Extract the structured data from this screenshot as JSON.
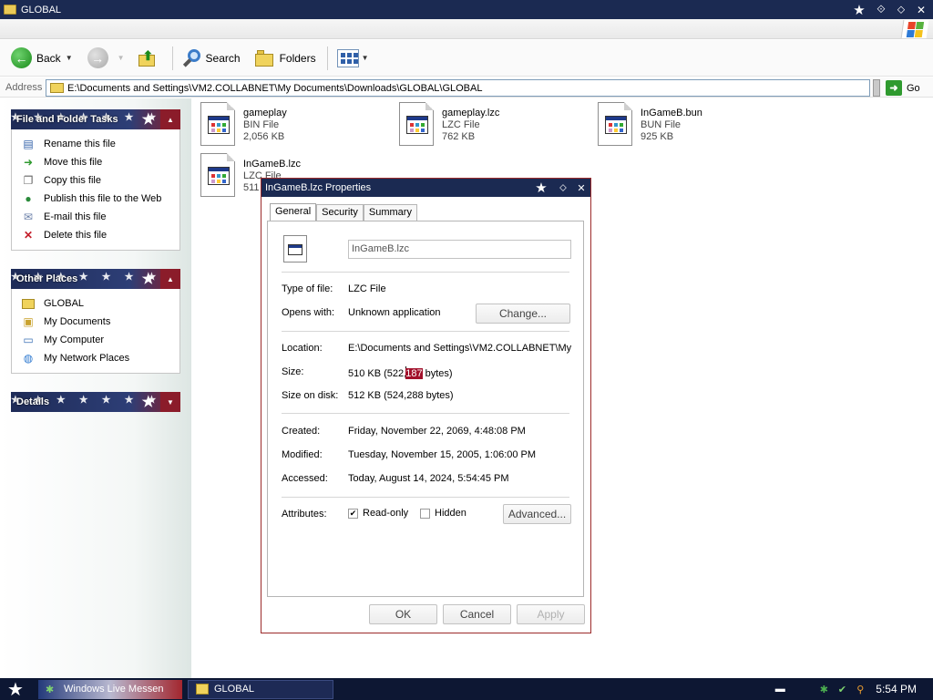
{
  "window": {
    "title": "GLOBAL"
  },
  "toolbar": {
    "back_label": "Back",
    "search_label": "Search",
    "folders_label": "Folders"
  },
  "address": {
    "label": "Address",
    "value": "E:\\Documents and Settings\\VM2.COLLABNET\\My Documents\\Downloads\\GLOBAL\\GLOBAL",
    "go_label": "Go"
  },
  "sidebar": {
    "file_tasks": {
      "title": "File and Folder Tasks",
      "items": [
        {
          "label": "Rename this file",
          "icon": "rename-icon"
        },
        {
          "label": "Move this file",
          "icon": "move-icon"
        },
        {
          "label": "Copy this file",
          "icon": "copy-icon"
        },
        {
          "label": "Publish this file to the Web",
          "icon": "globe-icon"
        },
        {
          "label": "E-mail this file",
          "icon": "email-icon"
        },
        {
          "label": "Delete this file",
          "icon": "delete-icon"
        }
      ]
    },
    "other_places": {
      "title": "Other Places",
      "items": [
        {
          "label": "GLOBAL",
          "icon": "folder-icon"
        },
        {
          "label": "My Documents",
          "icon": "my-documents-icon"
        },
        {
          "label": "My Computer",
          "icon": "my-computer-icon"
        },
        {
          "label": "My Network Places",
          "icon": "network-icon"
        }
      ]
    },
    "details": {
      "title": "Details"
    }
  },
  "files": [
    {
      "name": "gameplay",
      "type": "BIN File",
      "size": "2,056 KB"
    },
    {
      "name": "gameplay.lzc",
      "type": "LZC File",
      "size": "762 KB"
    },
    {
      "name": "InGameB.bun",
      "type": "BUN File",
      "size": "925 KB"
    },
    {
      "name": "InGameB.lzc",
      "type": "LZC File",
      "size": "511"
    }
  ],
  "dialog": {
    "title": "InGameB.lzc Properties",
    "tabs": [
      "General",
      "Security",
      "Summary"
    ],
    "filename": "InGameB.lzc",
    "type_label": "Type of file:",
    "type_value": "LZC File",
    "opens_label": "Opens with:",
    "opens_value": "Unknown application",
    "change_label": "Change...",
    "location_label": "Location:",
    "location_value": "E:\\Documents and Settings\\VM2.COLLABNET\\My",
    "size_label": "Size:",
    "size_pre": "510 KB (522,",
    "size_sel": "187",
    "size_post": " bytes)",
    "disk_label": "Size on disk:",
    "disk_value": "512 KB (524,288 bytes)",
    "created_label": "Created:",
    "created_value": "Friday, November 22, 2069, 4:48:08 PM",
    "modified_label": "Modified:",
    "modified_value": "Tuesday, November 15, 2005, 1:06:00 PM",
    "accessed_label": "Accessed:",
    "accessed_value": "Today, August 14, 2024, 5:54:45 PM",
    "attributes_label": "Attributes:",
    "readonly_label": "Read-only",
    "readonly_checked": true,
    "hidden_label": "Hidden",
    "hidden_checked": false,
    "advanced_label": "Advanced...",
    "ok_label": "OK",
    "cancel_label": "Cancel",
    "apply_label": "Apply"
  },
  "taskbar": {
    "msn_label": "Windows Live Messen",
    "global_label": "GLOBAL",
    "clock": "5:54 PM"
  },
  "colors": {
    "titlebar": "#1b2a52",
    "panel_red": "#8b1c2a",
    "selection": "#a2102b"
  }
}
